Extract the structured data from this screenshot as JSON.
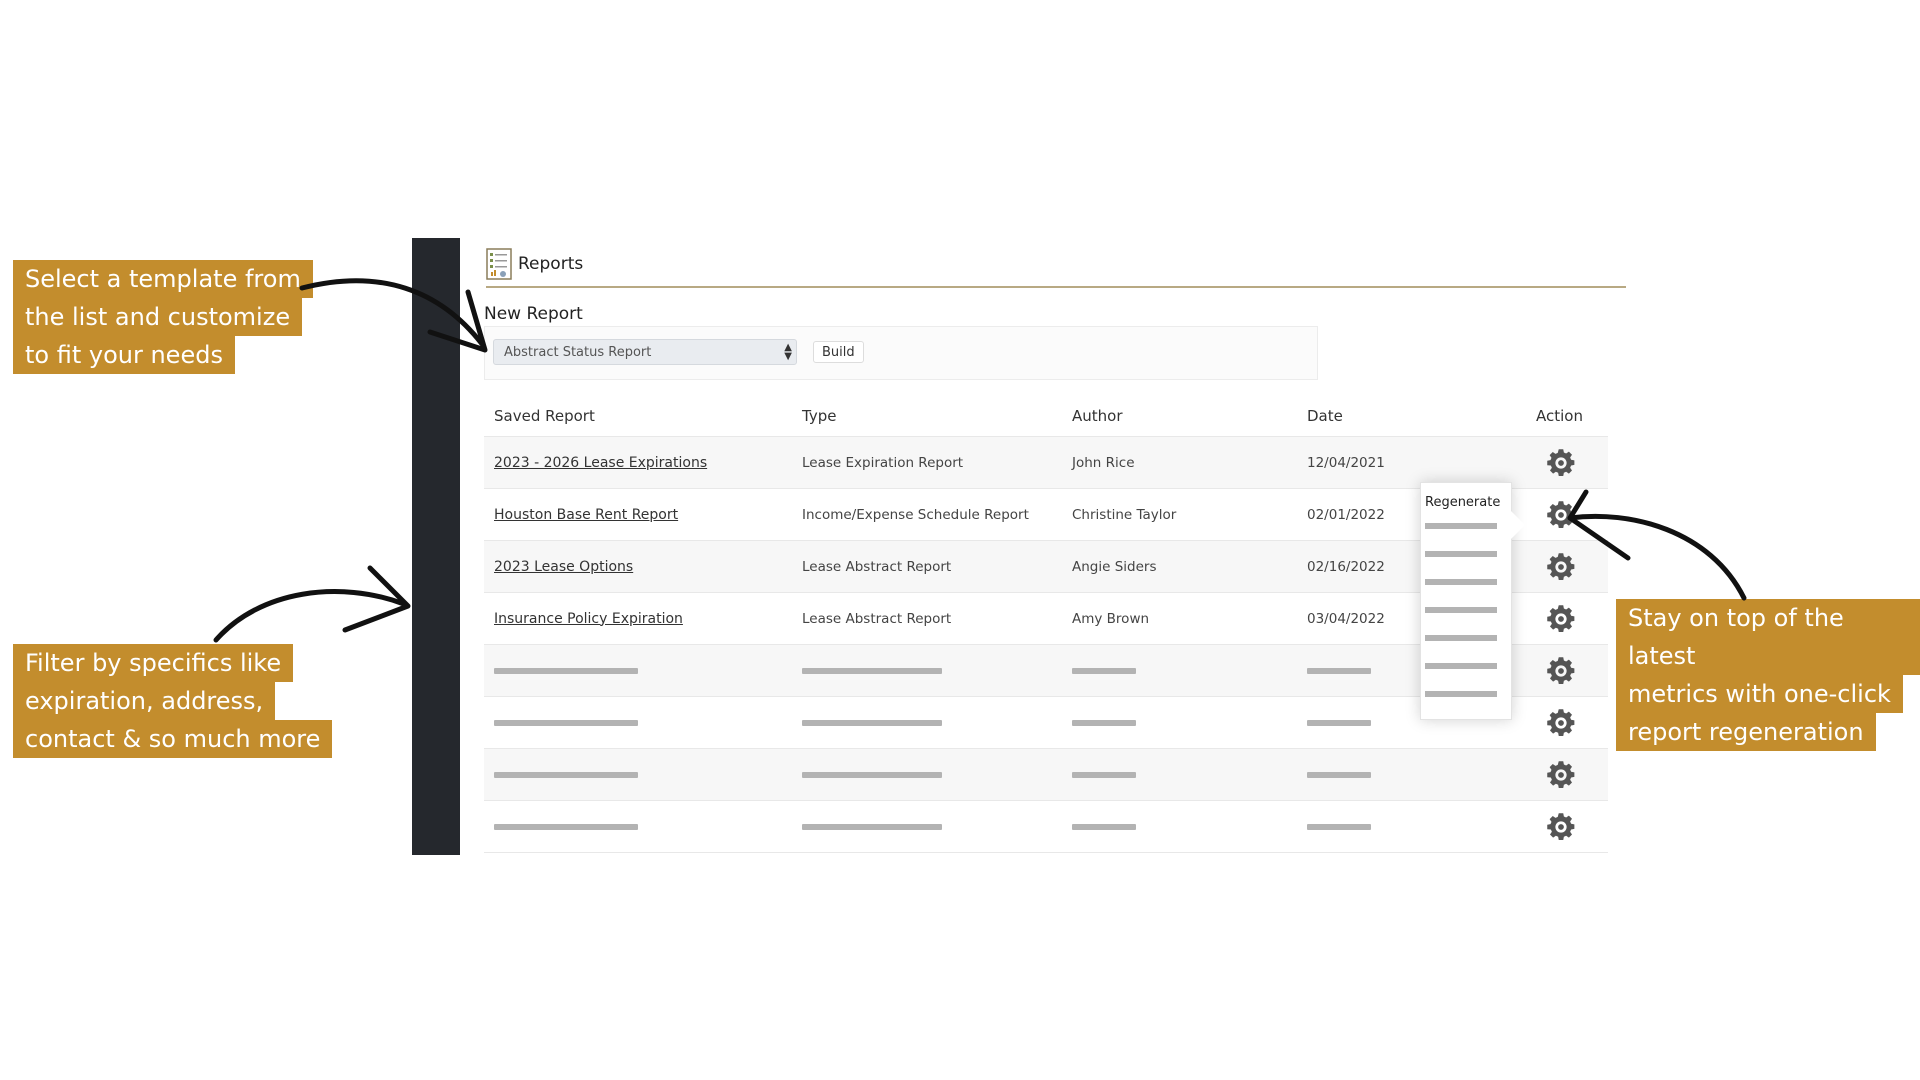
{
  "callouts": {
    "template": [
      "Select a template from",
      "the list and customize",
      "to fit your needs"
    ],
    "filter": [
      "Filter by specifics like",
      "expiration, address,",
      "contact & so much more"
    ],
    "regenerate": [
      "Stay on top of the latest",
      "metrics with one-click",
      "report regeneration"
    ]
  },
  "header": {
    "title": "Reports",
    "icon": "report-document-icon"
  },
  "new_report": {
    "label": "New Report",
    "selected_template": "Abstract Status Report",
    "build_label": "Build"
  },
  "table": {
    "columns": [
      "Saved Report",
      "Type",
      "Author",
      "Date",
      "Action"
    ],
    "rows": [
      {
        "name": "2023 - 2026 Lease Expirations",
        "type": "Lease Expiration Report",
        "author": "John Rice",
        "date": "12/04/2021"
      },
      {
        "name": "Houston Base Rent Report",
        "type": "Income/Expense Schedule Report",
        "author": "Christine Taylor",
        "date": "02/01/2022"
      },
      {
        "name": "2023 Lease Options",
        "type": "Lease Abstract Report",
        "author": "Angie Siders",
        "date": "02/16/2022"
      },
      {
        "name": "Insurance Policy Expiration",
        "type": "Lease Abstract Report",
        "author": "Amy Brown",
        "date": "03/04/2022"
      }
    ],
    "placeholder_row_count": 4
  },
  "action_menu": {
    "item_label": "Regenerate",
    "placeholder_item_count": 7
  },
  "colors": {
    "callout_bg": "#c38d2d",
    "sidebar": "#25282d",
    "rule": "#b8a983"
  }
}
